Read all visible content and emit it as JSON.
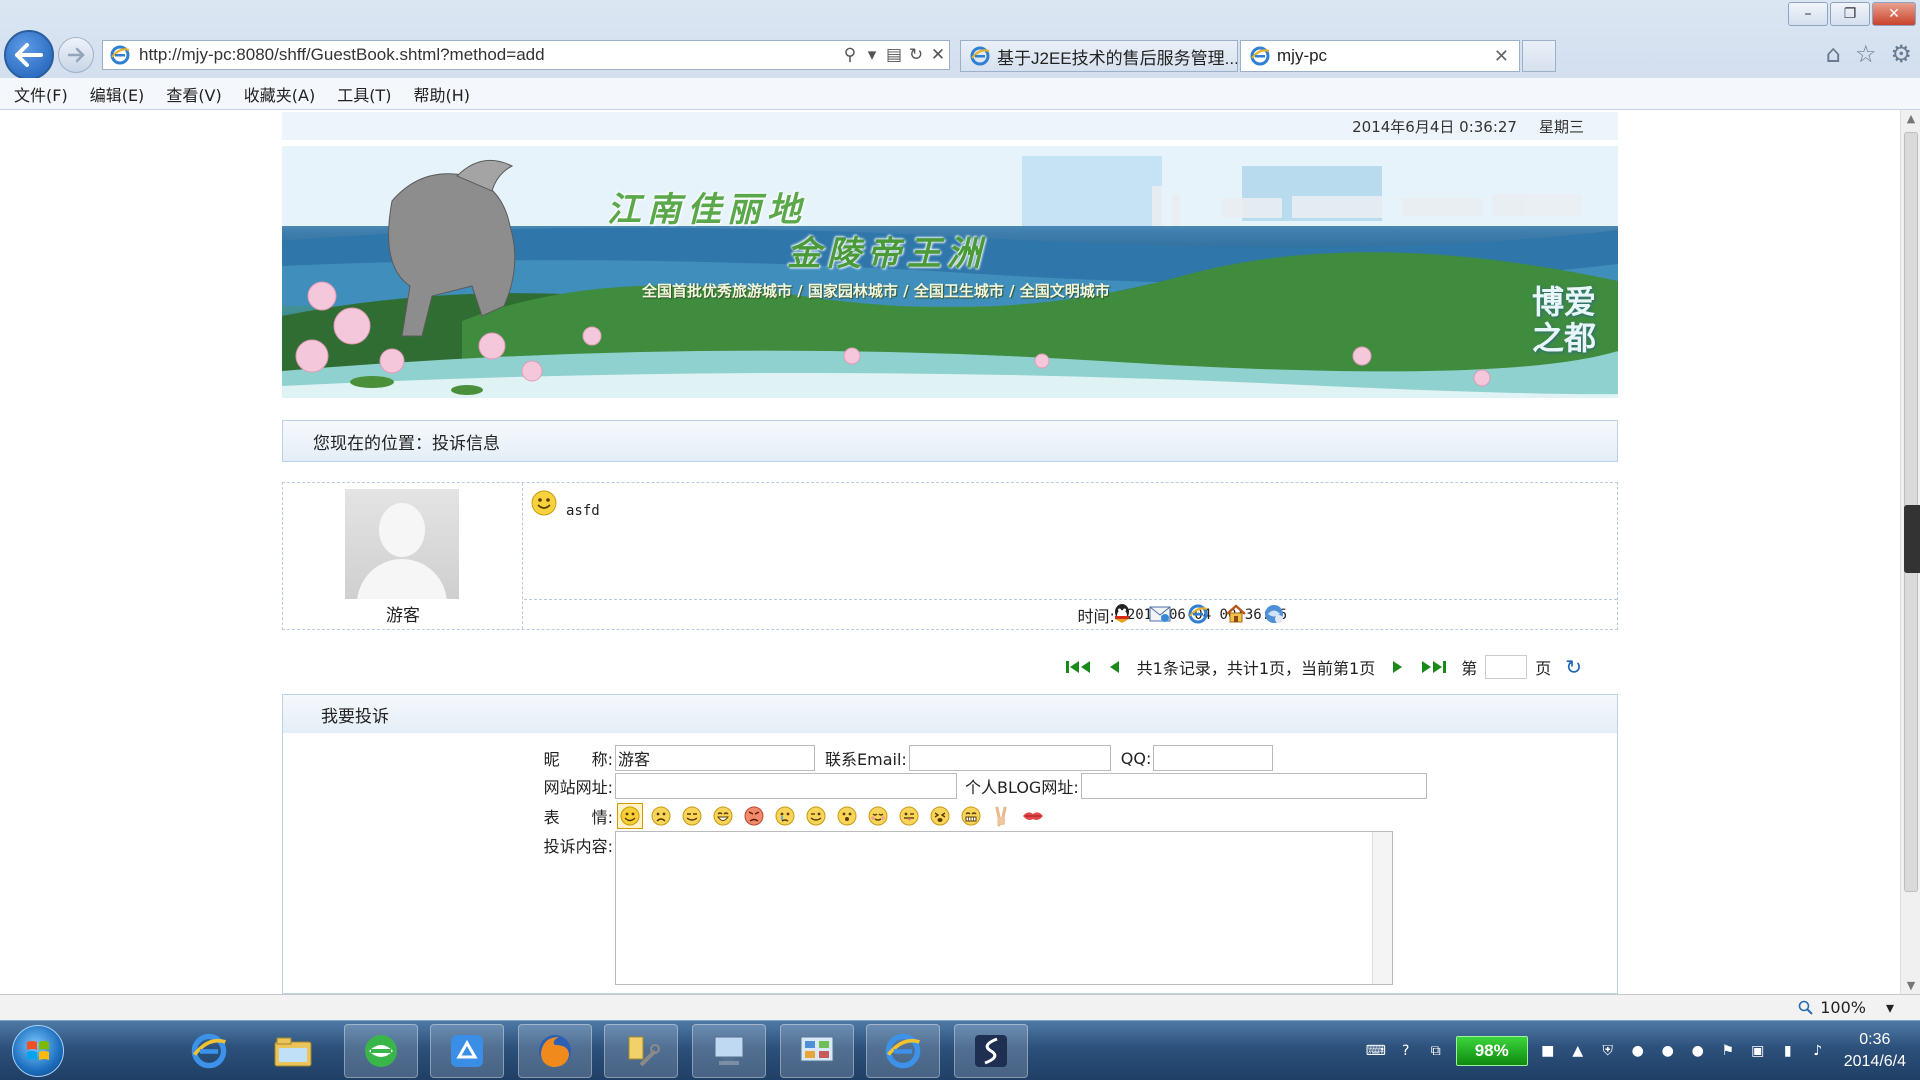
{
  "window": {
    "minimize_label": "–",
    "maximize_label": "❐",
    "close_label": "✕"
  },
  "address": {
    "url": "http://mjy-pc:8080/shff/GuestBook.shtml?method=add"
  },
  "tabs": [
    {
      "label": "基于J2EE技术的售后服务管理..."
    },
    {
      "label": "mjy-pc",
      "close": "✕"
    }
  ],
  "menu": [
    "文件(F)",
    "编辑(E)",
    "查看(V)",
    "收藏夹(A)",
    "工具(T)",
    "帮助(H)"
  ],
  "page": {
    "datetime": "2014年6月4日 0:36:27",
    "weekday": "星期三",
    "banner": {
      "title_line1": "江南佳丽地",
      "title_line2": "金陵帝王洲",
      "subtitle": "全国首批优秀旅游城市 / 国家园林城市 / 全国卫生城市 / 全国文明城市",
      "badge_line1": "博爱",
      "badge_line2": "之都"
    },
    "location": "您现在的位置：投诉信息",
    "message": {
      "author": "游客",
      "text": "asfd",
      "time_label": "时间:",
      "time_value": "2014-06-04 00:36:26",
      "tool_icons": [
        "qq-icon",
        "email-icon",
        "ie-homepage-icon",
        "home-icon",
        "reply-icon"
      ]
    },
    "pager": {
      "summary": "共1条记录，共计1页，当前第1页",
      "goto_prefix": "第",
      "goto_suffix": "页"
    },
    "form": {
      "title": "我要投诉",
      "nickname_label": "昵　　称:",
      "nickname_value": "游客",
      "email_label": "联系Email:",
      "qq_label": "QQ:",
      "website_label": "网站网址:",
      "blog_label": "个人BLOG网址:",
      "face_label": "表　　情:",
      "content_label": "投诉内容:",
      "faces": [
        "smile",
        "sad",
        "grin",
        "laugh",
        "angry",
        "cry",
        "wink",
        "cool",
        "shy",
        "tongue",
        "shock",
        "teeth",
        "victory",
        "kiss"
      ]
    }
  },
  "statusbar": {
    "zoom": "100%"
  },
  "taskbar": {
    "battery": "98%",
    "time": "0:36",
    "date": "2014/6/4"
  },
  "colors": {
    "accent_border": "#bcd2ea",
    "panel_bg": "#eef4fb",
    "pager_green": "#1a8a1a",
    "taskbar": "#2c517b"
  }
}
